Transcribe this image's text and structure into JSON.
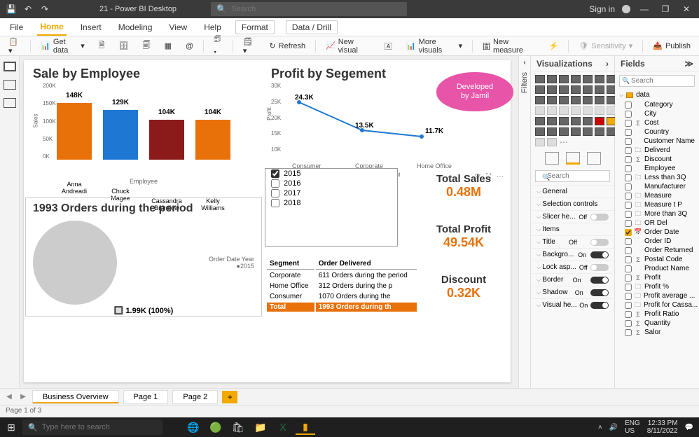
{
  "titlebar": {
    "doc_title": "21 - Power BI Desktop",
    "search_placeholder": "Search",
    "signin": "Sign in"
  },
  "ribbon_tabs": [
    "File",
    "Home",
    "Insert",
    "Modeling",
    "View",
    "Help",
    "Format",
    "Data / Drill"
  ],
  "ribbon_active": "Home",
  "ribbon_buttons": {
    "get_data": "Get data",
    "refresh": "Refresh",
    "new_visual": "New visual",
    "more_visuals": "More visuals",
    "new_measure": "New measure",
    "sensitivity": "Sensitivity",
    "publish": "Publish"
  },
  "filters_label": "Filters",
  "viz_pane": {
    "title": "Visualizations",
    "search_placeholder": "Search",
    "format_sections": [
      {
        "name": "General",
        "toggle": null
      },
      {
        "name": "Selection controls",
        "toggle": null
      },
      {
        "name": "Slicer he...",
        "toggle": "off"
      },
      {
        "name": "Items",
        "toggle": null
      },
      {
        "name": "Title",
        "toggle": "off"
      },
      {
        "name": "Backgro...",
        "toggle": "on"
      },
      {
        "name": "Lock asp...",
        "toggle": "off"
      },
      {
        "name": "Border",
        "toggle": "on"
      },
      {
        "name": "Shadow",
        "toggle": "on"
      },
      {
        "name": "Visual he...",
        "toggle": "on"
      }
    ]
  },
  "fields_pane": {
    "title": "Fields",
    "search_placeholder": "Search",
    "table": "data",
    "fields": [
      {
        "name": "Category",
        "checked": false,
        "icon": ""
      },
      {
        "name": "City",
        "checked": false,
        "icon": ""
      },
      {
        "name": "Cost",
        "checked": false,
        "icon": "Σ"
      },
      {
        "name": "Country",
        "checked": false,
        "icon": ""
      },
      {
        "name": "Customer Name",
        "checked": false,
        "icon": ""
      },
      {
        "name": "Deliverd",
        "checked": false,
        "icon": "🗀"
      },
      {
        "name": "Discount",
        "checked": false,
        "icon": "Σ"
      },
      {
        "name": "Employee",
        "checked": false,
        "icon": ""
      },
      {
        "name": "Less than 3Q",
        "checked": false,
        "icon": "🗀"
      },
      {
        "name": "Manufacturer",
        "checked": false,
        "icon": ""
      },
      {
        "name": "Measure",
        "checked": false,
        "icon": "🗀"
      },
      {
        "name": "Measure t P",
        "checked": false,
        "icon": "🗀"
      },
      {
        "name": "More than 3Q",
        "checked": false,
        "icon": "🗀"
      },
      {
        "name": "OR Del",
        "checked": false,
        "icon": "🗀"
      },
      {
        "name": "Order Date",
        "checked": true,
        "icon": "📅"
      },
      {
        "name": "Order ID",
        "checked": false,
        "icon": ""
      },
      {
        "name": "Order Returned",
        "checked": false,
        "icon": ""
      },
      {
        "name": "Postal Code",
        "checked": false,
        "icon": "Σ"
      },
      {
        "name": "Product Name",
        "checked": false,
        "icon": ""
      },
      {
        "name": "Profit",
        "checked": false,
        "icon": "Σ"
      },
      {
        "name": "Profit %",
        "checked": false,
        "icon": "🗀"
      },
      {
        "name": "Profit average ...",
        "checked": false,
        "icon": "🗀"
      },
      {
        "name": "Profit for Cassa...",
        "checked": false,
        "icon": "🗀"
      },
      {
        "name": "Profit Ratio",
        "checked": false,
        "icon": "Σ"
      },
      {
        "name": "Quantity",
        "checked": false,
        "icon": "Σ"
      },
      {
        "name": "Salor",
        "checked": false,
        "icon": "Σ"
      }
    ]
  },
  "pages": {
    "tabs": [
      "Business Overview",
      "Page 1",
      "Page 2"
    ],
    "active": 0,
    "status": "Page 1 of 3"
  },
  "taskbar": {
    "search_placeholder": "Type here to search",
    "lang1": "ENG",
    "lang2": "US",
    "time": "12:33 PM",
    "date": "8/11/2022"
  },
  "visuals": {
    "sale_by_employee": {
      "title": "Sale by Employee",
      "xlabel": "Employee",
      "ylabel": "Sales"
    },
    "profit_by_segment": {
      "title": "Profit by Segement",
      "ylabel": "Profit",
      "legend_partial": "...ment"
    },
    "bubble": {
      "line1": "Developed",
      "line2": "by Jamil"
    },
    "orders_title": "1993 Orders during the period",
    "donut_year_label": "Order Date Year",
    "donut_year_value": "2015",
    "donut_center": "1.99K (100%)",
    "slicer_header_left": "Segment",
    "slicer_header_right": "Order Delivered",
    "slicer_years": [
      "2015",
      "2016",
      "2017",
      "2018"
    ],
    "table_rows": [
      {
        "seg": "Corporate",
        "val": "611 Orders during the period"
      },
      {
        "seg": "Home Office",
        "val": "312 Orders during the p"
      },
      {
        "seg": "Consumer",
        "val": "1070 Orders during the"
      }
    ],
    "table_total": {
      "seg": "Total",
      "val": "1993 Orders during th"
    },
    "cards": {
      "sales_cap": "Total Sales",
      "sales_val": "0.48M",
      "profit_cap": "Total Profit",
      "profit_val": "49.54K",
      "discount_cap": "Discount",
      "discount_val": "0.32K"
    }
  },
  "chart_data": [
    {
      "id": "sale_by_employee",
      "type": "bar",
      "title": "Sale by Employee",
      "xlabel": "Employee",
      "ylabel": "Sales",
      "ylim": [
        0,
        200000
      ],
      "yticks": [
        "0K",
        "50K",
        "100K",
        "150K",
        "200K"
      ],
      "categories": [
        "Anna Andreadi",
        "Chuck Magee",
        "Cassandra Brandow",
        "Kelly Williams"
      ],
      "values": [
        148000,
        129000,
        104000,
        104000
      ],
      "value_labels": [
        "148K",
        "129K",
        "104K",
        "104K"
      ],
      "colors": [
        "#e8710a",
        "#1f77d4",
        "#8b1a1a",
        "#e8710a"
      ]
    },
    {
      "id": "profit_by_segment",
      "type": "line",
      "title": "Profit by Segement",
      "xlabel": "Segment",
      "ylabel": "Profit",
      "ylim": [
        0,
        30000
      ],
      "yticks": [
        "10K",
        "15K",
        "20K",
        "25K",
        "30K"
      ],
      "categories": [
        "Consumer",
        "Corporate",
        "Home Office"
      ],
      "values": [
        24300,
        13500,
        11700
      ],
      "value_labels": [
        "24.3K",
        "13.5K",
        "11.7K"
      ]
    },
    {
      "id": "orders_donut",
      "type": "pie",
      "title": "1993 Orders during the period",
      "categories": [
        "2015"
      ],
      "values": [
        1993
      ],
      "center_label": "1.99K (100%)"
    }
  ]
}
